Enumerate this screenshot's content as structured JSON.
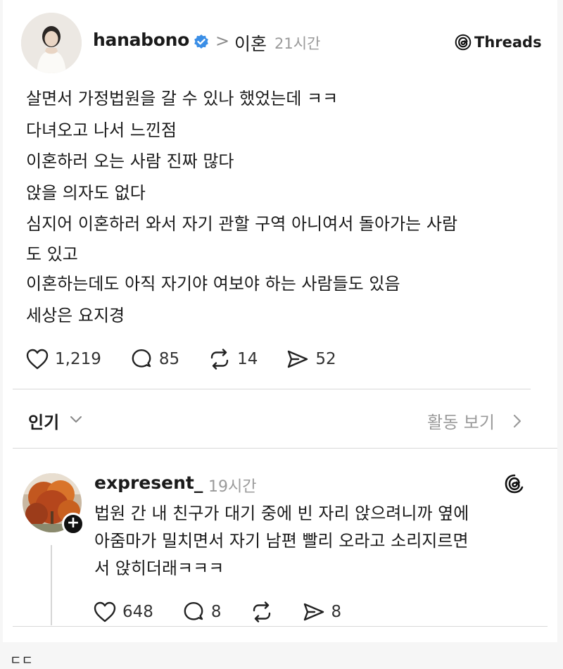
{
  "post": {
    "author": "hanabono",
    "separator": ">",
    "topic": "이혼",
    "time": "21시간",
    "brand": "Threads",
    "lines": [
      "살면서 가정법원을 갈 수 있나 했었는데 ㅋㅋ",
      "다녀오고 나서 느낀점",
      "이혼하러 오는 사람 진짜 많다",
      "앉을 의자도 없다",
      "심지어 이혼하러 와서 자기 관할 구역 아니여서 돌아가는 사람",
      "도 있고",
      "이혼하는데도 아직 자기야 여보야 하는 사람들도 있음",
      "세상은 요지경"
    ],
    "stats": {
      "likes": "1,219",
      "replies": "85",
      "reposts": "14",
      "shares": "52"
    }
  },
  "sort": {
    "label": "인기",
    "activity": "활동 보기"
  },
  "reply": {
    "author": "expresent_",
    "time": "19시간",
    "follow_symbol": "+",
    "lines": [
      "법원 간 내 친구가 대기 중에 빈 자리 앉으려니까 옆에",
      "아줌마가 밀치면서 자기 남편 빨리 오라고 소리지르면",
      "서 앉히더래ㅋㅋㅋ"
    ],
    "stats": {
      "likes": "648",
      "replies": "8",
      "shares": "8"
    }
  },
  "footer": {
    "text": "ㄷㄷ"
  },
  "colors": {
    "verified": "#3a8ee6",
    "muted": "#9a9a9a",
    "text": "#1a1a1a"
  },
  "icons": [
    "verified-badge-icon",
    "threads-logo-icon",
    "heart-icon",
    "comment-icon",
    "repost-icon",
    "share-icon",
    "chevron-down-icon",
    "chevron-right-icon"
  ]
}
